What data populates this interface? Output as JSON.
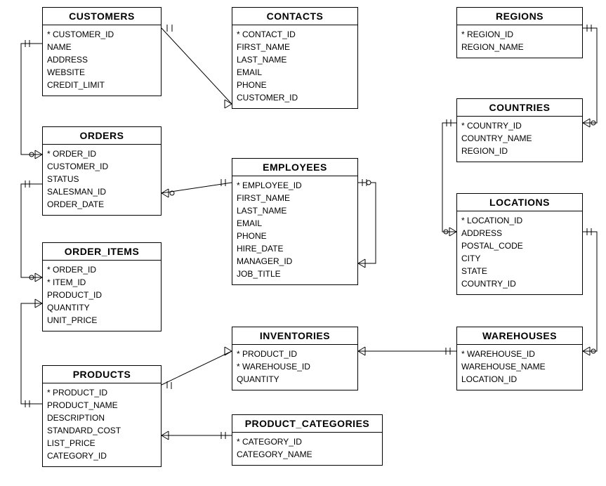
{
  "entities": {
    "customers": {
      "title": "CUSTOMERS",
      "attrs": [
        "* CUSTOMER_ID",
        "  NAME",
        "  ADDRESS",
        "  WEBSITE",
        "  CREDIT_LIMIT"
      ]
    },
    "contacts": {
      "title": "CONTACTS",
      "attrs": [
        "* CONTACT_ID",
        "  FIRST_NAME",
        "  LAST_NAME",
        "  EMAIL",
        "  PHONE",
        "  CUSTOMER_ID"
      ]
    },
    "regions": {
      "title": "REGIONS",
      "attrs": [
        "* REGION_ID",
        "  REGION_NAME"
      ]
    },
    "orders": {
      "title": "ORDERS",
      "attrs": [
        "* ORDER_ID",
        "  CUSTOMER_ID",
        "  STATUS",
        "  SALESMAN_ID",
        "  ORDER_DATE"
      ]
    },
    "employees": {
      "title": "EMPLOYEES",
      "attrs": [
        "* EMPLOYEE_ID",
        "  FIRST_NAME",
        "  LAST_NAME",
        "  EMAIL",
        "  PHONE",
        "  HIRE_DATE",
        "  MANAGER_ID",
        "  JOB_TITLE"
      ]
    },
    "countries": {
      "title": "COUNTRIES",
      "attrs": [
        "* COUNTRY_ID",
        "  COUNTRY_NAME",
        "  REGION_ID"
      ]
    },
    "order_items": {
      "title": "ORDER_ITEMS",
      "attrs": [
        "* ORDER_ID",
        "* ITEM_ID",
        "  PRODUCT_ID",
        "  QUANTITY",
        "  UNIT_PRICE"
      ]
    },
    "locations": {
      "title": "LOCATIONS",
      "attrs": [
        "* LOCATION_ID",
        "  ADDRESS",
        "  POSTAL_CODE",
        "  CITY",
        "  STATE",
        "  COUNTRY_ID"
      ]
    },
    "products": {
      "title": "PRODUCTS",
      "attrs": [
        "* PRODUCT_ID",
        "  PRODUCT_NAME",
        "  DESCRIPTION",
        "  STANDARD_COST",
        "  LIST_PRICE",
        "  CATEGORY_ID"
      ]
    },
    "inventories": {
      "title": "INVENTORIES",
      "attrs": [
        "* PRODUCT_ID",
        "* WAREHOUSE_ID",
        "  QUANTITY"
      ]
    },
    "warehouses": {
      "title": "WAREHOUSES",
      "attrs": [
        "* WAREHOUSE_ID",
        "  WAREHOUSE_NAME",
        "  LOCATION_ID"
      ]
    },
    "product_categories": {
      "title": "PRODUCT_CATEGORIES",
      "attrs": [
        "* CATEGORY_ID",
        "  CATEGORY_NAME"
      ]
    }
  }
}
